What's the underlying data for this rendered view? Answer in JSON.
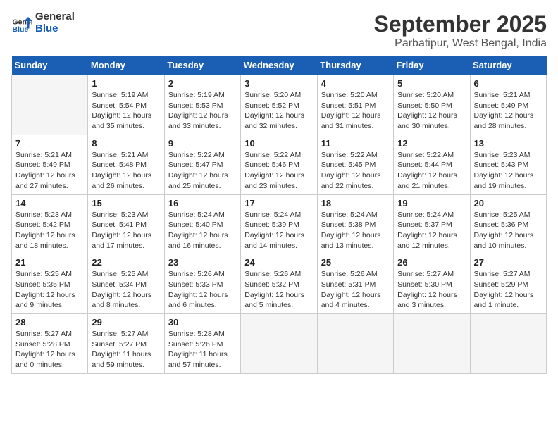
{
  "logo": {
    "line1": "General",
    "line2": "Blue"
  },
  "title": "September 2025",
  "subtitle": "Parbatipur, West Bengal, India",
  "weekdays": [
    "Sunday",
    "Monday",
    "Tuesday",
    "Wednesday",
    "Thursday",
    "Friday",
    "Saturday"
  ],
  "weeks": [
    [
      {
        "day": "",
        "info": ""
      },
      {
        "day": "1",
        "info": "Sunrise: 5:19 AM\nSunset: 5:54 PM\nDaylight: 12 hours\nand 35 minutes."
      },
      {
        "day": "2",
        "info": "Sunrise: 5:19 AM\nSunset: 5:53 PM\nDaylight: 12 hours\nand 33 minutes."
      },
      {
        "day": "3",
        "info": "Sunrise: 5:20 AM\nSunset: 5:52 PM\nDaylight: 12 hours\nand 32 minutes."
      },
      {
        "day": "4",
        "info": "Sunrise: 5:20 AM\nSunset: 5:51 PM\nDaylight: 12 hours\nand 31 minutes."
      },
      {
        "day": "5",
        "info": "Sunrise: 5:20 AM\nSunset: 5:50 PM\nDaylight: 12 hours\nand 30 minutes."
      },
      {
        "day": "6",
        "info": "Sunrise: 5:21 AM\nSunset: 5:49 PM\nDaylight: 12 hours\nand 28 minutes."
      }
    ],
    [
      {
        "day": "7",
        "info": "Sunrise: 5:21 AM\nSunset: 5:49 PM\nDaylight: 12 hours\nand 27 minutes."
      },
      {
        "day": "8",
        "info": "Sunrise: 5:21 AM\nSunset: 5:48 PM\nDaylight: 12 hours\nand 26 minutes."
      },
      {
        "day": "9",
        "info": "Sunrise: 5:22 AM\nSunset: 5:47 PM\nDaylight: 12 hours\nand 25 minutes."
      },
      {
        "day": "10",
        "info": "Sunrise: 5:22 AM\nSunset: 5:46 PM\nDaylight: 12 hours\nand 23 minutes."
      },
      {
        "day": "11",
        "info": "Sunrise: 5:22 AM\nSunset: 5:45 PM\nDaylight: 12 hours\nand 22 minutes."
      },
      {
        "day": "12",
        "info": "Sunrise: 5:22 AM\nSunset: 5:44 PM\nDaylight: 12 hours\nand 21 minutes."
      },
      {
        "day": "13",
        "info": "Sunrise: 5:23 AM\nSunset: 5:43 PM\nDaylight: 12 hours\nand 19 minutes."
      }
    ],
    [
      {
        "day": "14",
        "info": "Sunrise: 5:23 AM\nSunset: 5:42 PM\nDaylight: 12 hours\nand 18 minutes."
      },
      {
        "day": "15",
        "info": "Sunrise: 5:23 AM\nSunset: 5:41 PM\nDaylight: 12 hours\nand 17 minutes."
      },
      {
        "day": "16",
        "info": "Sunrise: 5:24 AM\nSunset: 5:40 PM\nDaylight: 12 hours\nand 16 minutes."
      },
      {
        "day": "17",
        "info": "Sunrise: 5:24 AM\nSunset: 5:39 PM\nDaylight: 12 hours\nand 14 minutes."
      },
      {
        "day": "18",
        "info": "Sunrise: 5:24 AM\nSunset: 5:38 PM\nDaylight: 12 hours\nand 13 minutes."
      },
      {
        "day": "19",
        "info": "Sunrise: 5:24 AM\nSunset: 5:37 PM\nDaylight: 12 hours\nand 12 minutes."
      },
      {
        "day": "20",
        "info": "Sunrise: 5:25 AM\nSunset: 5:36 PM\nDaylight: 12 hours\nand 10 minutes."
      }
    ],
    [
      {
        "day": "21",
        "info": "Sunrise: 5:25 AM\nSunset: 5:35 PM\nDaylight: 12 hours\nand 9 minutes."
      },
      {
        "day": "22",
        "info": "Sunrise: 5:25 AM\nSunset: 5:34 PM\nDaylight: 12 hours\nand 8 minutes."
      },
      {
        "day": "23",
        "info": "Sunrise: 5:26 AM\nSunset: 5:33 PM\nDaylight: 12 hours\nand 6 minutes."
      },
      {
        "day": "24",
        "info": "Sunrise: 5:26 AM\nSunset: 5:32 PM\nDaylight: 12 hours\nand 5 minutes."
      },
      {
        "day": "25",
        "info": "Sunrise: 5:26 AM\nSunset: 5:31 PM\nDaylight: 12 hours\nand 4 minutes."
      },
      {
        "day": "26",
        "info": "Sunrise: 5:27 AM\nSunset: 5:30 PM\nDaylight: 12 hours\nand 3 minutes."
      },
      {
        "day": "27",
        "info": "Sunrise: 5:27 AM\nSunset: 5:29 PM\nDaylight: 12 hours\nand 1 minute."
      }
    ],
    [
      {
        "day": "28",
        "info": "Sunrise: 5:27 AM\nSunset: 5:28 PM\nDaylight: 12 hours\nand 0 minutes."
      },
      {
        "day": "29",
        "info": "Sunrise: 5:27 AM\nSunset: 5:27 PM\nDaylight: 11 hours\nand 59 minutes."
      },
      {
        "day": "30",
        "info": "Sunrise: 5:28 AM\nSunset: 5:26 PM\nDaylight: 11 hours\nand 57 minutes."
      },
      {
        "day": "",
        "info": ""
      },
      {
        "day": "",
        "info": ""
      },
      {
        "day": "",
        "info": ""
      },
      {
        "day": "",
        "info": ""
      }
    ]
  ]
}
